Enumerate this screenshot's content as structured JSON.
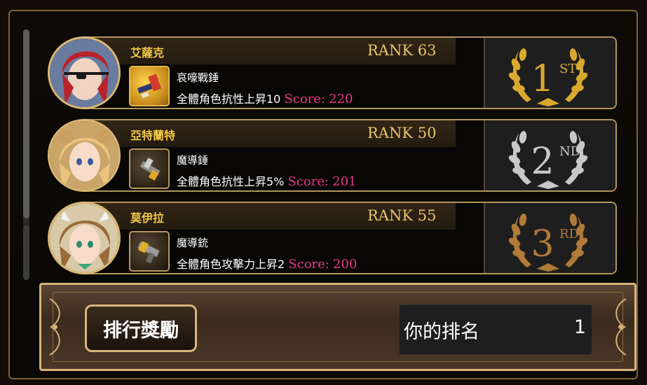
{
  "rankings": [
    {
      "name": "艾薩克",
      "rank_label": "RANK 63",
      "item_name": "哀嚎戰錘",
      "effect": "全體角色抗性上昇10",
      "score_label": "Score:",
      "score": "220",
      "place_number": "1",
      "place_suffix": "ST",
      "place_color": "#d9a82e",
      "item_icon": "hammer-icon"
    },
    {
      "name": "亞特蘭特",
      "rank_label": "RANK 50",
      "item_name": "魔導錘",
      "effect": "全體角色抗性上昇5%",
      "score_label": "Score:",
      "score": "201",
      "place_number": "2",
      "place_suffix": "ND",
      "place_color": "#c8c8c8",
      "item_icon": "magic-hammer-icon"
    },
    {
      "name": "莫伊拉",
      "rank_label": "RANK 55",
      "item_name": "魔導銃",
      "effect": "全體角色攻擊力上昇2",
      "score_label": "Score:",
      "score": "200",
      "place_number": "3",
      "place_suffix": "RD",
      "place_color": "#b07a38",
      "item_icon": "magic-gun-icon"
    }
  ],
  "footer": {
    "reward_button": "排行獎勵",
    "my_rank_label": "你的排名",
    "my_rank_value": "1"
  }
}
